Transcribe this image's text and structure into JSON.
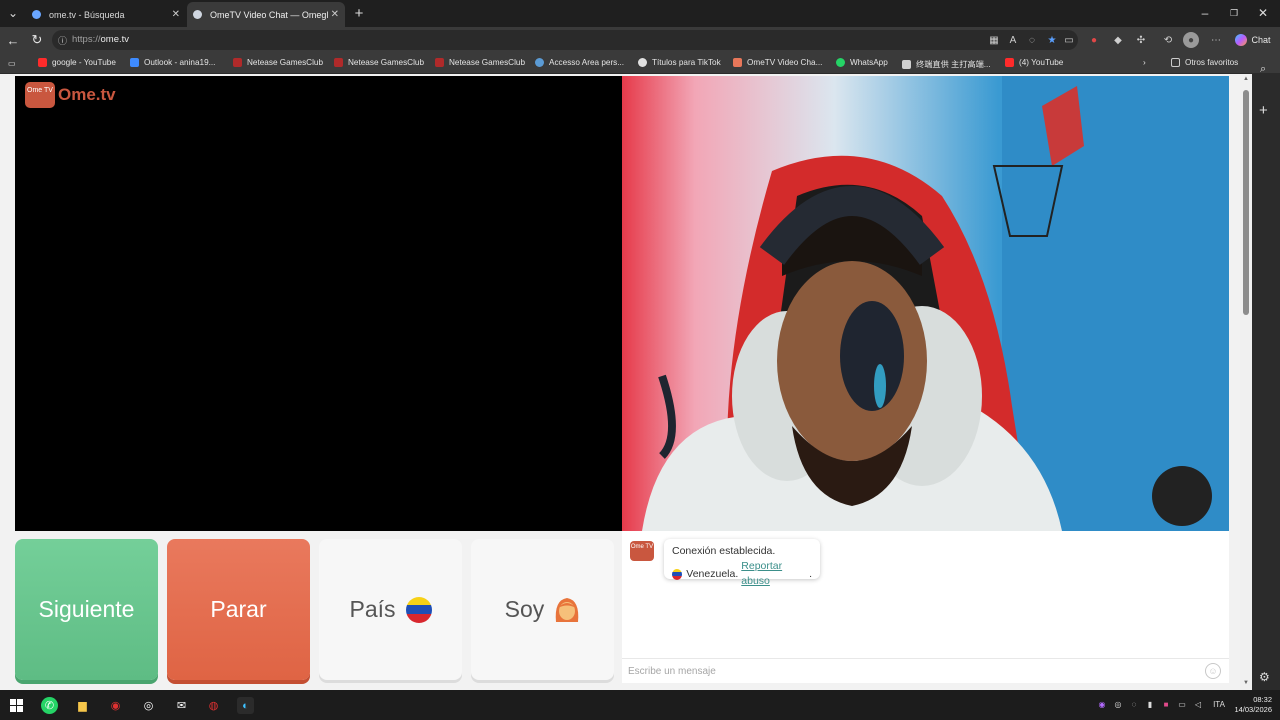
{
  "browser": {
    "tabs": [
      {
        "title": "ome.tv - Búsqueda",
        "favicon_color": "#6aa6ff",
        "active": false
      },
      {
        "title": "OmeTV Video Chat — Omegl",
        "favicon_color": "#cfd6e0",
        "active": true
      }
    ],
    "new_tab_glyph": "+",
    "address": {
      "protocol": "https://",
      "host": "ome.tv"
    },
    "bookmarks": [
      {
        "label": "google - YouTube",
        "color": "#ff2b2b"
      },
      {
        "label": "Outlook - anina19...",
        "color": "#3e8bff"
      },
      {
        "label": "Netease GamesClub",
        "color": "#b02a2a"
      },
      {
        "label": "Netease GamesClub",
        "color": "#b02a2a"
      },
      {
        "label": "Netease GamesClub",
        "color": "#b02a2a"
      },
      {
        "label": "Accesso Area pers...",
        "color": "#5b9bd5"
      },
      {
        "label": "Títulos para TikTok",
        "color": "#e0e0e0"
      },
      {
        "label": "OmeTV Video Cha...",
        "color": "#e8775a"
      },
      {
        "label": "WhatsApp",
        "color": "#25d366"
      },
      {
        "label": "终端直供 主打高端...",
        "color": "#d0d0d0"
      },
      {
        "label": "(4) YouTube",
        "color": "#ff2b2b"
      }
    ],
    "other_favorites": "Otros favoritos",
    "copilot_label": "Chat"
  },
  "site": {
    "logo_small": "Ome TV",
    "logo_text": "Ome.tv"
  },
  "controls": {
    "next": "Siguiente",
    "stop": "Parar",
    "country": "País",
    "gender": "Soy"
  },
  "chat": {
    "avatar_text": "Ome TV",
    "status": "Conexión establecida.",
    "country": "Venezuela.",
    "report": "Reportar abuso",
    "report_suffix": ".",
    "input_placeholder": "Escribe un mensaje"
  },
  "taskbar": {
    "lang": "ITA",
    "time": "08:32",
    "date": "14/03/2026"
  },
  "colors": {
    "next": "#65c28b",
    "stop": "#e56d4f",
    "brand": "#c9573f",
    "link": "#3b8f8a"
  }
}
